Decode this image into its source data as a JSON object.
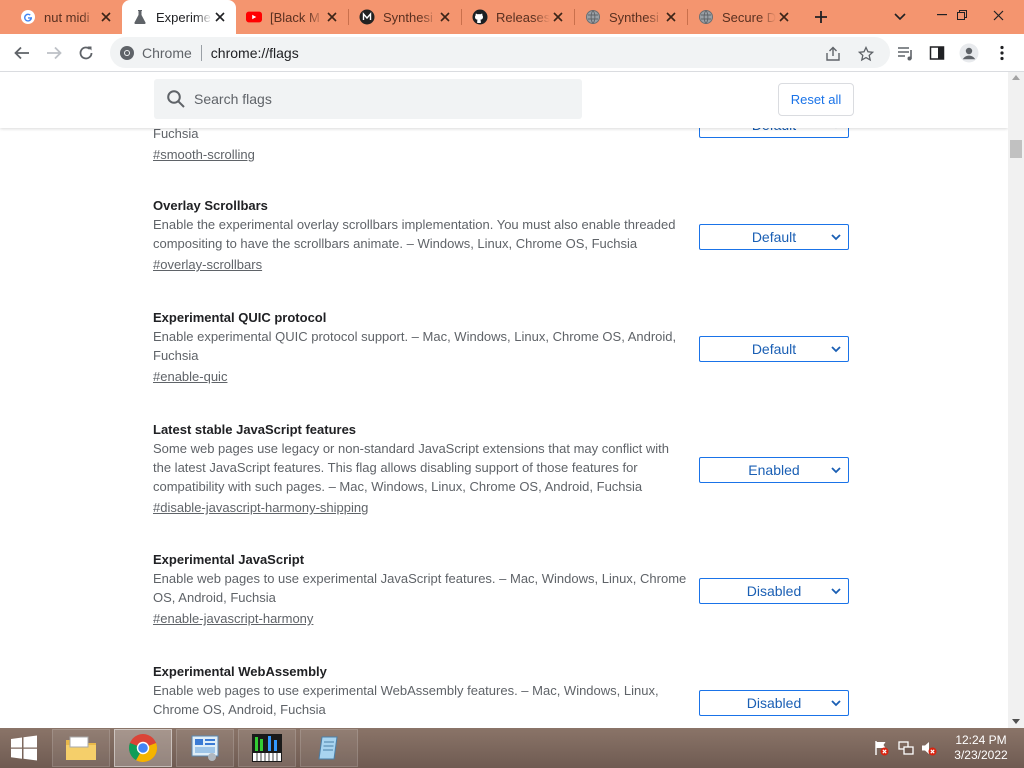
{
  "browser": {
    "tabs": [
      {
        "title": "nut midi",
        "favicon": "google-g-icon",
        "active": false
      },
      {
        "title": "Experime",
        "favicon": "flask-icon",
        "active": true
      },
      {
        "title": "[Black M",
        "favicon": "youtube-icon",
        "active": false
      },
      {
        "title": "Synthesi",
        "favicon": "synthesia-icon",
        "active": false
      },
      {
        "title": "Releases",
        "favicon": "github-icon",
        "active": false
      },
      {
        "title": "Synthesi",
        "favicon": "globe-icon",
        "active": false
      },
      {
        "title": "Secure D",
        "favicon": "globe-icon",
        "active": false
      }
    ],
    "omnibox": {
      "scheme_label": "Chrome",
      "url": "chrome://flags"
    },
    "colors": {
      "tabstrip": "#f4956f",
      "accent": "#1a73e8"
    }
  },
  "flags_page": {
    "search_placeholder": "Search flags",
    "reset_label": "Reset all",
    "partial_flag": {
      "desc_tail": "Fuchsia",
      "link": "#smooth-scrolling",
      "select_value": "Default"
    },
    "flags": [
      {
        "name": "Overlay Scrollbars",
        "description": "Enable the experimental overlay scrollbars implementation. You must also enable threaded compositing to have the scrollbars animate. – Windows, Linux, Chrome OS, Fuchsia",
        "link": "#overlay-scrollbars",
        "value": "Default"
      },
      {
        "name": "Experimental QUIC protocol",
        "description": "Enable experimental QUIC protocol support. – Mac, Windows, Linux, Chrome OS, Android, Fuchsia",
        "link": "#enable-quic",
        "value": "Default"
      },
      {
        "name": "Latest stable JavaScript features",
        "description": "Some web pages use legacy or non-standard JavaScript extensions that may conflict with the latest JavaScript features. This flag allows disabling support of those features for compatibility with such pages. – Mac, Windows, Linux, Chrome OS, Android, Fuchsia",
        "link": "#disable-javascript-harmony-shipping",
        "value": "Enabled"
      },
      {
        "name": "Experimental JavaScript",
        "description": "Enable web pages to use experimental JavaScript features. – Mac, Windows, Linux, Chrome OS, Android, Fuchsia",
        "link": "#enable-javascript-harmony",
        "value": "Disabled"
      },
      {
        "name": "Experimental WebAssembly",
        "description": "Enable web pages to use experimental WebAssembly features. – Mac, Windows, Linux, Chrome OS, Android, Fuchsia",
        "link": "",
        "value": "Disabled"
      }
    ]
  },
  "taskbar": {
    "apps": [
      "file-explorer-icon",
      "chrome-icon",
      "control-panel-icon",
      "synthesia-piano-icon",
      "notepad-icon"
    ],
    "clock": {
      "time": "12:24 PM",
      "date": "3/23/2022"
    }
  }
}
